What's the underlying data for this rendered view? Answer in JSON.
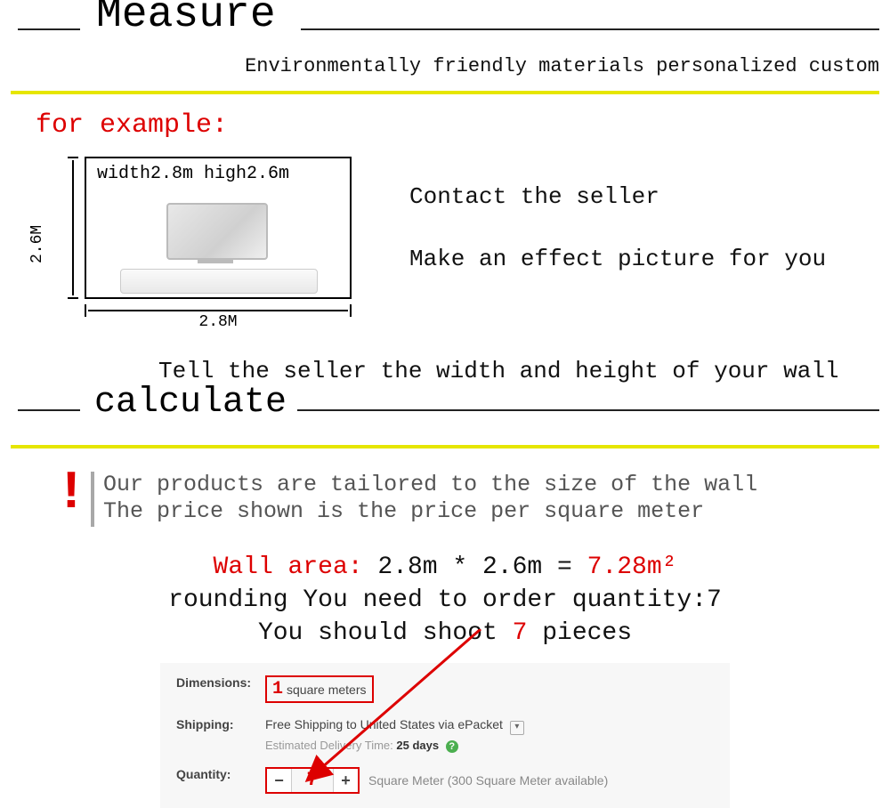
{
  "header": {
    "measure_title": "Measure",
    "subtitle": "Environmentally friendly materials personalized custom"
  },
  "example": {
    "label": "for example:",
    "wall_dims_text": "width2.8m  high2.6m",
    "vertical_label": "2.6M",
    "horizontal_label": "2.8M",
    "contact_line1": "Contact the seller",
    "contact_line2": "Make an effect picture for you",
    "tell_seller": "Tell the seller the width and height of your wall"
  },
  "calculate": {
    "title": "calculate",
    "tailored_line1": "Our products are tailored to the size of the wall",
    "tailored_line2": "The price shown is the price per square meter",
    "area_label": "Wall area:",
    "area_expr": " 2.8m * 2.6m = ",
    "area_result": "7.28m²",
    "rounding_line_a": "rounding  You need to order quantity:",
    "rounding_qty": "7",
    "shoot_a": "You should shoot ",
    "shoot_qty": "7",
    "shoot_b": " pieces"
  },
  "order": {
    "dimensions_label": "Dimensions:",
    "dimensions_one": "1",
    "dimensions_unit": "square meters",
    "shipping_label": "Shipping:",
    "shipping_text": "Free Shipping to United States via ePacket",
    "shipping_sub_a": "Estimated Delivery Time: ",
    "shipping_days": "25 days",
    "quantity_label": "Quantity:",
    "quantity_value": "7",
    "quantity_note": "Square Meter (300 Square Meter available)"
  }
}
